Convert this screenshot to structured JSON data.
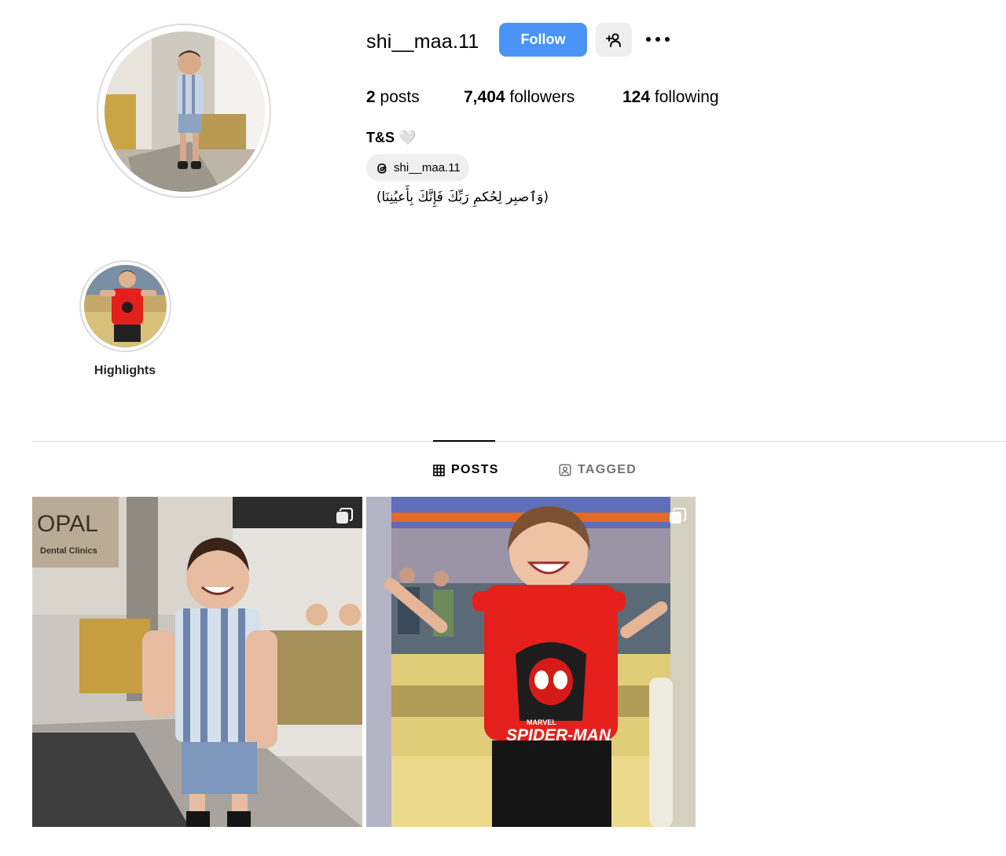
{
  "profile": {
    "username": "shi__maa.11",
    "follow_label": "Follow",
    "fullname": "T&S 🤍",
    "threads_handle": "shi__maa.11",
    "bio": "(وَٱصبِر لِحُكمِ رَبِّكَ فَإِنَّكَ بِأَعيُنِنَا)"
  },
  "stats": {
    "posts_count": "2",
    "posts_label": "posts",
    "followers_count": "7,404",
    "followers_label": "followers",
    "following_count": "124",
    "following_label": "following"
  },
  "highlights": [
    {
      "label": "Highlights"
    }
  ],
  "tabs": {
    "posts": "POSTS",
    "tagged": "TAGGED"
  },
  "posts": [
    {
      "sign_line1": "OPAL",
      "sign_line2": "Dental Clinics",
      "multi": true
    },
    {
      "shirt_text": "SPIDER-MAN",
      "shirt_brand": "MARVEL",
      "multi": true
    }
  ],
  "colors": {
    "follow_blue": "#4a94f8",
    "chip_gray": "#efefef",
    "divider": "#dbdbdb",
    "muted_text": "#737373"
  },
  "icons": {
    "add_user": "person-plus-icon",
    "more": "three-dots-icon",
    "threads": "threads-logo-icon",
    "grid": "grid-icon",
    "tagged": "tagged-person-icon",
    "multi": "carousel-icon"
  }
}
